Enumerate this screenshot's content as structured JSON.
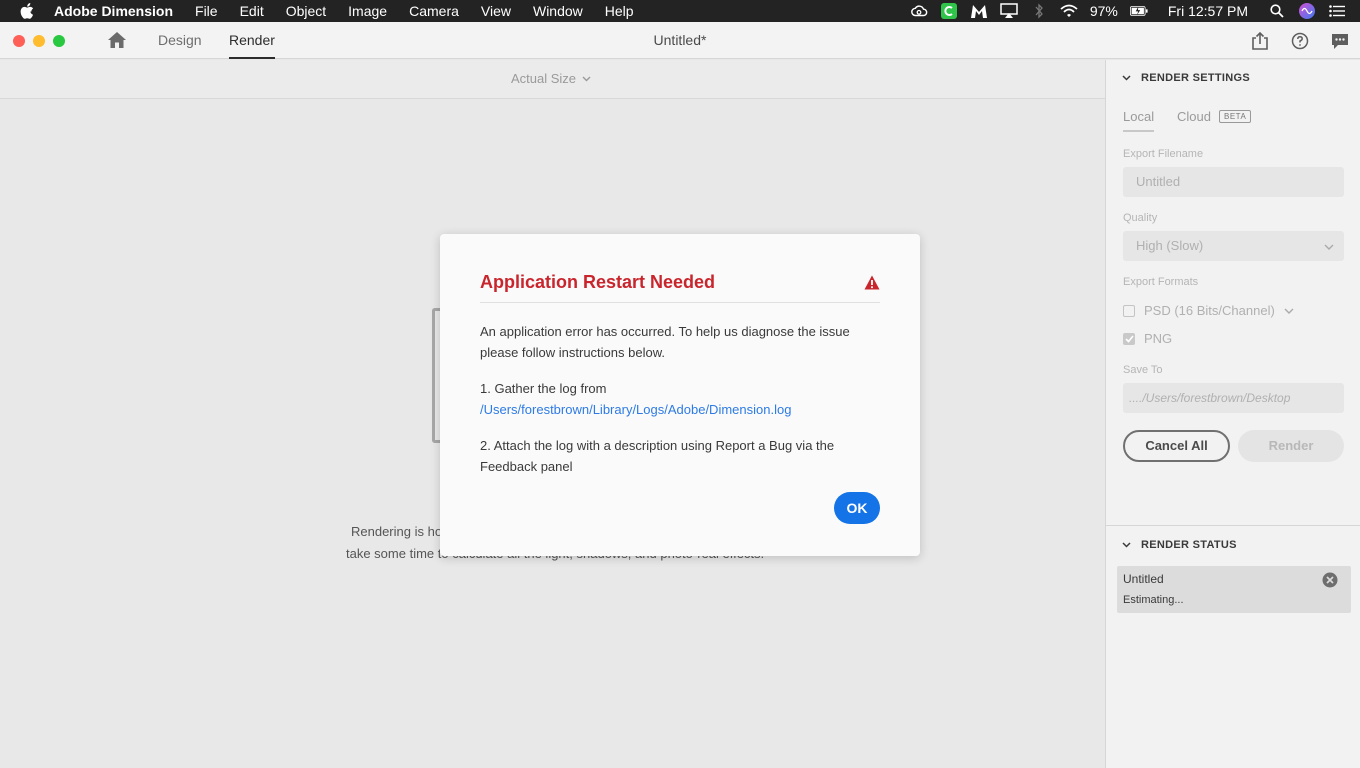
{
  "menubar": {
    "app_name": "Adobe Dimension",
    "menus": [
      "File",
      "Edit",
      "Object",
      "Image",
      "Camera",
      "View",
      "Window",
      "Help"
    ],
    "battery": "97%",
    "clock": "Fri 12:57 PM",
    "status_icons": [
      "creative-cloud-icon",
      "green-app-icon",
      "malwarebytes-icon",
      "airplay-icon",
      "bluetooth-icon",
      "wifi-icon",
      "battery-icon",
      "spotlight-icon",
      "siri-icon",
      "notification-center-icon"
    ]
  },
  "titlebar": {
    "tabs": {
      "design": "Design",
      "render": "Render"
    },
    "document_title": "Untitled*"
  },
  "canvas": {
    "zoom": "Actual Size",
    "message_line1": "Rendering is ho",
    "message_line2": "take some time to calculate all the light, shadows, and photo-real effects."
  },
  "render_settings": {
    "header": "RENDER SETTINGS",
    "tab_local": "Local",
    "tab_cloud": "Cloud",
    "badge_beta": "BETA",
    "export_filename_label": "Export Filename",
    "export_filename_value": "Untitled",
    "quality_label": "Quality",
    "quality_value": "High (Slow)",
    "export_formats_label": "Export Formats",
    "format_psd": "PSD (16 Bits/Channel)",
    "format_png": "PNG",
    "save_to_label": "Save To",
    "save_to_value": "..../Users/forestbrown/Desktop",
    "cancel_all": "Cancel All",
    "render": "Render"
  },
  "render_status": {
    "header": "RENDER STATUS",
    "item_name": "Untitled",
    "item_state": "Estimating..."
  },
  "dialog": {
    "title": "Application Restart Needed",
    "body1": "An application error has occurred. To help us diagnose the issue please follow instructions below.",
    "step1": "1. Gather the log from",
    "log_path": "/Users/forestbrown/Library/Logs/Adobe/Dimension.log",
    "step2": "2. Attach the log with a description using Report a Bug via the Feedback panel",
    "ok": "OK",
    "title_color": "#c9252d",
    "accent_color": "#1473e6"
  }
}
